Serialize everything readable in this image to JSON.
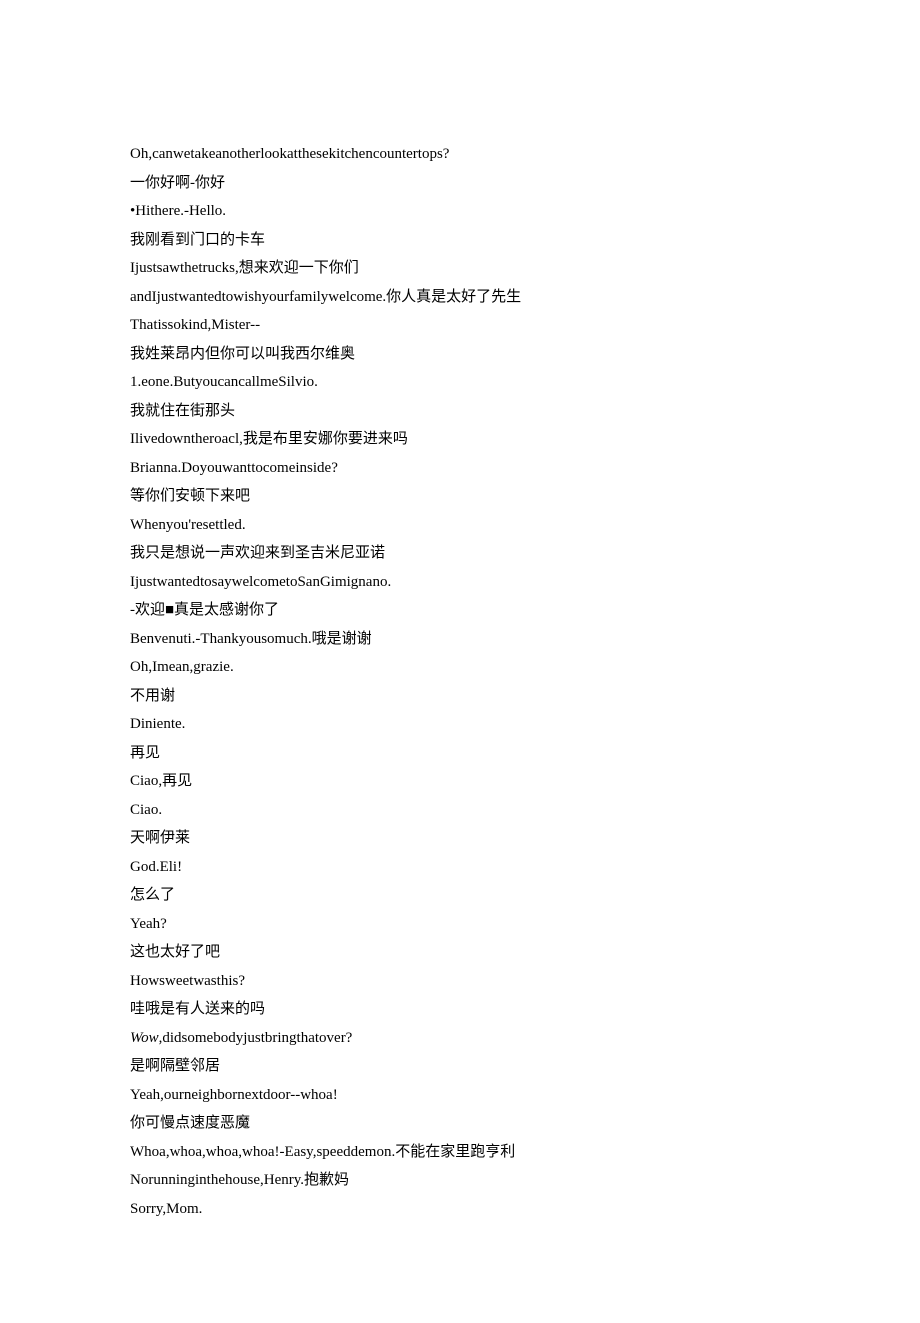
{
  "lines": [
    {
      "text": "Oh,canwetakeanotherlookatthesekitchencountertops?"
    },
    {
      "text": "一你好啊-你好"
    },
    {
      "text": "•Hithere.-Hello."
    },
    {
      "text": "我刚看到门口的卡车"
    },
    {
      "text": "Ijustsawthetrucks,想来欢迎一下你们"
    },
    {
      "text": "andIjustwantedtowishyourfamilywelcome.你人真是太好了先生"
    },
    {
      "text": "Thatissokind,Mister--"
    },
    {
      "text": "我姓莱昂内但你可以叫我西尔维奥"
    },
    {
      "text": "1.eone.ButyoucancallmeSilvio."
    },
    {
      "text": "我就住在街那头"
    },
    {
      "text": "Ilivedowntheroacl,我是布里安娜你要进来吗"
    },
    {
      "text": "Brianna.Doyouwanttocomeinside?"
    },
    {
      "text": "等你们安顿下来吧"
    },
    {
      "text": "Whenyou'resettled."
    },
    {
      "text": "我只是想说一声欢迎来到圣吉米尼亚诺"
    },
    {
      "text": "IjustwantedtosaywelcometoSanGimignano."
    },
    {
      "text": "-欢迎■真是太感谢你了"
    },
    {
      "text": "Benvenuti.-Thankyousomuch.哦是谢谢"
    },
    {
      "text": "Oh,Imean,grazie."
    },
    {
      "text": "不用谢"
    },
    {
      "text": "Diniente."
    },
    {
      "text": "再见"
    },
    {
      "text": "Ciao,再见"
    },
    {
      "text": "Ciao."
    },
    {
      "text": "天啊伊莱"
    },
    {
      "text": "God.Eli!"
    },
    {
      "text": "怎么了"
    },
    {
      "text": "Yeah?"
    },
    {
      "text": "这也太好了吧"
    },
    {
      "text": "Howsweetwasthis?"
    },
    {
      "text": "哇哦是有人送来的吗"
    },
    {
      "text": "Wow,didsomebodyjustbringthatover?",
      "italicPrefix": "Wow"
    },
    {
      "text": "是啊隔壁邻居"
    },
    {
      "text": "Yeah,ourneighbornextdoor--whoa!"
    },
    {
      "text": "你可慢点速度恶魔"
    },
    {
      "text": "Whoa,whoa,whoa,whoa!-Easy,speeddemon.不能在家里跑亨利"
    },
    {
      "text": "Norunninginthehouse,Henry.抱歉妈"
    },
    {
      "text": "Sorry,Mom."
    }
  ]
}
